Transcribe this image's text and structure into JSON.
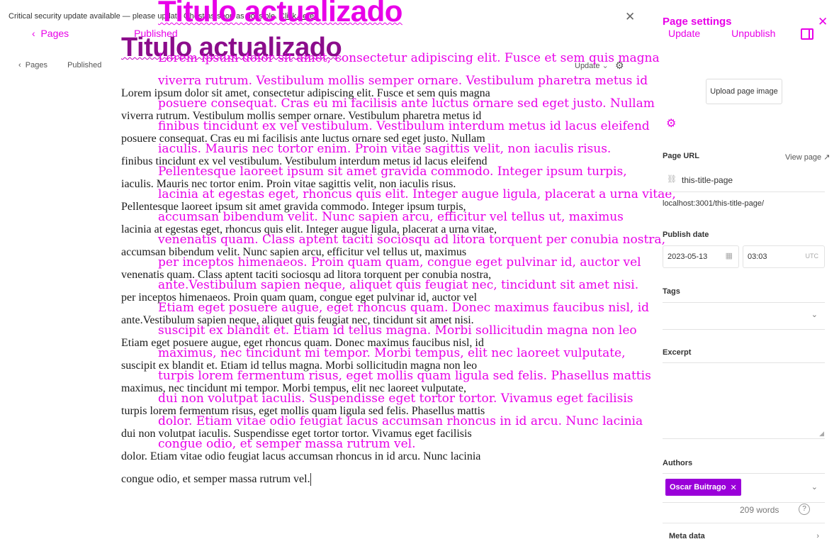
{
  "notice": {
    "text": "Critical security update available — please update Ghost as soon as possible. ",
    "link": "Click here."
  },
  "overlay": {
    "title": "Titulo actualizado",
    "nav": {
      "back": "Pages",
      "status": "Published"
    },
    "body_lines": [
      "Lorem ipsum dolor sit amet, consectetur adipiscing elit. Fusce et sem quis magna",
      "viverra rutrum. Vestibulum mollis semper ornare. Vestibulum pharetra metus id",
      "posuere consequat. Cras eu mi facilisis ante luctus ornare sed eget justo. Nullam",
      "finibus tincidunt ex vel vestibulum. Vestibulum interdum metus id lacus eleifend",
      "iaculis. Mauris nec tortor enim. Proin vitae sagittis velit, non iaculis risus.",
      "Pellentesque laoreet ipsum sit amet gravida commodo. Integer ipsum turpis,",
      "lacinia at egestas eget, rhoncus quis elit. Integer augue ligula, placerat a urna vitae,",
      "accumsan bibendum velit. Nunc sapien arcu, efficitur vel tellus ut, maximus",
      "venenatis quam. Class aptent taciti sociosqu ad litora torquent per conubia nostra,",
      "per inceptos himenaeos. Proin quam quam, congue eget pulvinar id, auctor vel",
      "ante.Vestibulum sapien neque, aliquet quis feugiat nec, tincidunt sit amet nisi.",
      "Etiam eget posuere augue, eget rhoncus quam. Donec maximus faucibus nisl, id",
      "suscipit ex blandit et. Etiam id tellus magna. Morbi sollicitudin magna non leo",
      "maximus, nec tincidunt mi tempor. Morbi tempus, elit nec laoreet vulputate,",
      "turpis lorem fermentum risus, eget mollis quam ligula sed felis. Phasellus mattis",
      "dui non volutpat iaculis. Suspendisse eget tortor tortor. Vivamus eget facilisis",
      "dolor. Etiam vitae odio feugiat lacus accumsan rhoncus in id arcu. Nunc lacinia",
      "congue odio, et semper massa rutrum vel."
    ]
  },
  "editor": {
    "title": "Titulo actualizado",
    "nav": {
      "back": "Pages",
      "status": "Published"
    },
    "update_label": "Update",
    "body_lines": [
      "Lorem ipsum dolor sit amet, consectetur adipiscing elit. Fusce et sem quis magna",
      "viverra rutrum. Vestibulum mollis semper ornare. Vestibulum pharetra metus id",
      "posuere consequat. Cras eu mi facilisis ante luctus ornare sed eget justo. Nullam",
      "finibus tincidunt ex vel vestibulum. Vestibulum interdum metus id lacus eleifend",
      "iaculis. Mauris nec tortor enim. Proin vitae sagittis velit, non iaculis risus.",
      "Pellentesque laoreet ipsum sit amet gravida commodo. Integer ipsum turpis,",
      "lacinia at egestas eget, rhoncus quis elit. Integer augue ligula, placerat a urna vitae,",
      "accumsan bibendum velit. Nunc sapien arcu, efficitur vel tellus ut, maximus",
      "venenatis quam. Class aptent taciti sociosqu ad litora torquent per conubia nostra,",
      "per inceptos himenaeos. Proin quam quam, congue eget pulvinar id, auctor vel",
      "ante.Vestibulum sapien neque, aliquet quis feugiat nec, tincidunt sit amet nisi.",
      "Etiam eget posuere augue, eget rhoncus quam. Donec maximus faucibus nisl, id",
      "suscipit ex blandit et. Etiam id tellus magna. Morbi sollicitudin magna non leo",
      "maximus, nec tincidunt mi tempor. Morbi tempus, elit nec laoreet vulputate,",
      "turpis lorem fermentum risus, eget mollis quam ligula sed felis. Phasellus mattis",
      "dui non volutpat iaculis. Suspendisse eget tortor tortor. Vivamus eget facilisis",
      "dolor. Etiam vitae odio feugiat lacus accumsan rhoncus in id arcu. Nunc lacinia",
      "congue odio, et semper massa rutrum vel."
    ]
  },
  "panel": {
    "title": "Page settings",
    "update": "Update",
    "unpublish": "Unpublish",
    "upload_image": "Upload page image",
    "page_url_label": "Page URL",
    "view_page": "View page",
    "slug": "this-title-page",
    "full_url": "localhost:3001/this-title-page/",
    "publish_date_label": "Publish date",
    "date": "2023-05-13",
    "time": "03:03",
    "timezone": "UTC",
    "tags_label": "Tags",
    "excerpt_label": "Excerpt",
    "authors_label": "Authors",
    "author": "Oscar Buitrago",
    "word_count": "209 words",
    "meta_data": "Meta data"
  },
  "colors": {
    "accent": "#e800e8",
    "chip": "#9a00d9"
  }
}
